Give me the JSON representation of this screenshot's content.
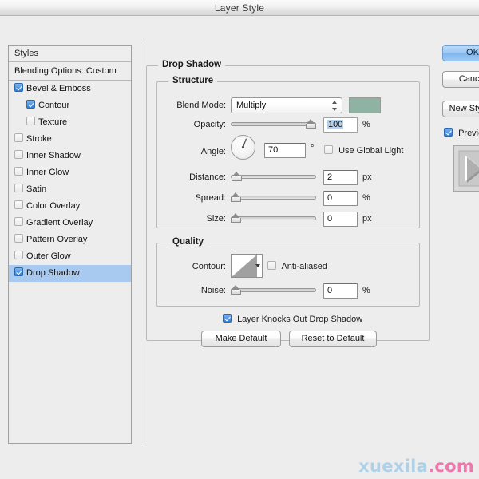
{
  "window": {
    "title": "Layer Style"
  },
  "styles_panel": {
    "header": "Styles",
    "blending_options": "Blending Options: Custom",
    "effects": [
      {
        "label": "Bevel & Emboss",
        "checked": true,
        "indent": false,
        "selected": false
      },
      {
        "label": "Contour",
        "checked": true,
        "indent": true,
        "selected": false
      },
      {
        "label": "Texture",
        "checked": false,
        "indent": true,
        "selected": false
      },
      {
        "label": "Stroke",
        "checked": false,
        "indent": false,
        "selected": false
      },
      {
        "label": "Inner Shadow",
        "checked": false,
        "indent": false,
        "selected": false
      },
      {
        "label": "Inner Glow",
        "checked": false,
        "indent": false,
        "selected": false
      },
      {
        "label": "Satin",
        "checked": false,
        "indent": false,
        "selected": false
      },
      {
        "label": "Color Overlay",
        "checked": false,
        "indent": false,
        "selected": false
      },
      {
        "label": "Gradient Overlay",
        "checked": false,
        "indent": false,
        "selected": false
      },
      {
        "label": "Pattern Overlay",
        "checked": false,
        "indent": false,
        "selected": false
      },
      {
        "label": "Outer Glow",
        "checked": false,
        "indent": false,
        "selected": false
      },
      {
        "label": "Drop Shadow",
        "checked": true,
        "indent": false,
        "selected": true
      }
    ]
  },
  "main": {
    "group_title": "Drop Shadow",
    "structure": {
      "title": "Structure",
      "blend_mode": {
        "label": "Blend Mode:",
        "value": "Multiply",
        "swatch_color": "#8fb3a3"
      },
      "opacity": {
        "label": "Opacity:",
        "value": "100",
        "unit": "%",
        "slider_percent": 100
      },
      "angle": {
        "label": "Angle:",
        "value": "70",
        "unit": "°",
        "degrees": 70,
        "use_global_light": {
          "label": "Use Global Light",
          "checked": false
        }
      },
      "distance": {
        "label": "Distance:",
        "value": "2",
        "unit": "px",
        "slider_percent": 1
      },
      "spread": {
        "label": "Spread:",
        "value": "0",
        "unit": "%",
        "slider_percent": 0
      },
      "size": {
        "label": "Size:",
        "value": "0",
        "unit": "px",
        "slider_percent": 0
      }
    },
    "quality": {
      "title": "Quality",
      "contour": {
        "label": "Contour:",
        "anti_aliased": {
          "label": "Anti-aliased",
          "checked": false
        }
      },
      "noise": {
        "label": "Noise:",
        "value": "0",
        "unit": "%",
        "slider_percent": 0
      }
    },
    "knockout": {
      "label": "Layer Knocks Out Drop Shadow",
      "checked": true
    },
    "buttons": {
      "make_default": "Make Default",
      "reset_to_default": "Reset to Default"
    }
  },
  "right_panel": {
    "ok": "OK",
    "cancel": "Cancel",
    "new_style": "New Style...",
    "preview": {
      "label": "Preview",
      "checked": true
    }
  },
  "watermark": {
    "name": "xuexila",
    "tld": ".com"
  }
}
